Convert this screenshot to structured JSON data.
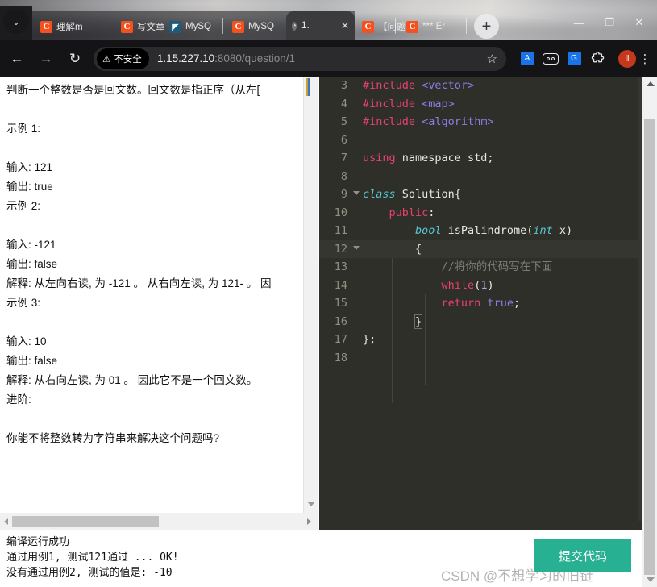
{
  "browser": {
    "tabs": [
      {
        "favicon": "csdn-icon",
        "favicon_text": "C",
        "title": "理解m"
      },
      {
        "favicon": "csdn-icon",
        "favicon_text": "C",
        "title": "写文章"
      },
      {
        "favicon": "mysql-icon",
        "favicon_text": "◤",
        "title": "MySQ"
      },
      {
        "favicon": "csdn-icon",
        "favicon_text": "C",
        "title": "MySQ"
      },
      {
        "favicon": "csdn-icon",
        "favicon_text": "C",
        "title": "【问题"
      },
      {
        "favicon": "csdn-icon",
        "favicon_text": "C",
        "title": "*** Er"
      }
    ],
    "active_tab": {
      "favicon": "globe-icon",
      "favicon_text": "◔",
      "title": "1.",
      "close": "✕"
    },
    "new_tab_label": "+",
    "chevron_label": "⌄",
    "window_controls": {
      "minimize": "—",
      "maximize": "❐",
      "close": "✕"
    },
    "nav": {
      "back": "←",
      "forward": "→",
      "reload": "↻"
    },
    "security": {
      "icon": "warning-triangle-icon",
      "glyph": "⚠",
      "label": "不安全"
    },
    "url": {
      "host": "1.15.227.10",
      "path": ":8080/question/1"
    },
    "star": "☆",
    "extensions": [
      {
        "name": "translate-extension-icon",
        "glyph": "A"
      },
      {
        "name": "goggles-extension-icon",
        "glyph": ""
      },
      {
        "name": "google-docs-extension-icon",
        "glyph": "G"
      },
      {
        "name": "extensions-puzzle-icon",
        "glyph": "⬡"
      }
    ],
    "profile_initial": "li",
    "menu_glyph": "⋮"
  },
  "problem": {
    "lines": [
      "判断一个整数是否是回文数。回文数是指正序（从左[",
      "",
      "示例 1:",
      "",
      "输入: 121",
      "输出: true",
      "示例 2:",
      "",
      "输入: -121",
      "输出: false",
      "解释: 从左向右读, 为 -121 。 从右向左读, 为 121- 。 因",
      "示例 3:",
      "",
      "输入: 10",
      "输出: false",
      "解释: 从右向左读, 为 01 。 因此它不是一个回文数。",
      "进阶:",
      "",
      "你能不将整数转为字符串来解决这个问题吗?"
    ]
  },
  "editor": {
    "lines": [
      {
        "num": "3",
        "fold": false,
        "tokens": [
          {
            "t": "#include",
            "c": "k-pre"
          },
          {
            "t": " ",
            "c": "k-id"
          },
          {
            "t": "<vector>",
            "c": "k-str"
          }
        ]
      },
      {
        "num": "4",
        "fold": false,
        "tokens": [
          {
            "t": "#include",
            "c": "k-pre"
          },
          {
            "t": " ",
            "c": "k-id"
          },
          {
            "t": "<map>",
            "c": "k-str"
          }
        ]
      },
      {
        "num": "5",
        "fold": false,
        "tokens": [
          {
            "t": "#include",
            "c": "k-pre"
          },
          {
            "t": " ",
            "c": "k-id"
          },
          {
            "t": "<algorithm>",
            "c": "k-str"
          }
        ]
      },
      {
        "num": "6",
        "fold": false,
        "tokens": []
      },
      {
        "num": "7",
        "fold": false,
        "tokens": [
          {
            "t": "using",
            "c": "k-kw"
          },
          {
            "t": " namespace ",
            "c": "k-kw2"
          },
          {
            "t": "std;",
            "c": "k-id"
          }
        ]
      },
      {
        "num": "8",
        "fold": false,
        "tokens": []
      },
      {
        "num": "9",
        "fold": true,
        "tokens": [
          {
            "t": "class",
            "c": "k-type"
          },
          {
            "t": " Solution{",
            "c": "k-id"
          }
        ]
      },
      {
        "num": "10",
        "fold": false,
        "tokens": [
          {
            "t": "    ",
            "c": "k-id"
          },
          {
            "t": "public",
            "c": "k-kw"
          },
          {
            "t": ":",
            "c": "k-id"
          }
        ]
      },
      {
        "num": "11",
        "fold": false,
        "tokens": [
          {
            "t": "        ",
            "c": "k-id"
          },
          {
            "t": "bool",
            "c": "k-type"
          },
          {
            "t": " isPalindrome(",
            "c": "k-id"
          },
          {
            "t": "int",
            "c": "k-type"
          },
          {
            "t": " x)",
            "c": "k-id"
          }
        ]
      },
      {
        "num": "12",
        "fold": true,
        "cur": true,
        "tokens": [
          {
            "t": "        {",
            "c": "k-id"
          }
        ],
        "caret": true
      },
      {
        "num": "13",
        "fold": false,
        "tokens": [
          {
            "t": "            ",
            "c": "k-id"
          },
          {
            "t": "//将你的代码写在下面",
            "c": "k-cmt"
          }
        ]
      },
      {
        "num": "14",
        "fold": false,
        "tokens": [
          {
            "t": "            ",
            "c": "k-id"
          },
          {
            "t": "while",
            "c": "k-kw"
          },
          {
            "t": "(",
            "c": "k-id"
          },
          {
            "t": "1",
            "c": "k-num"
          },
          {
            "t": ")",
            "c": "k-id"
          }
        ]
      },
      {
        "num": "15",
        "fold": false,
        "tokens": [
          {
            "t": "            ",
            "c": "k-id"
          },
          {
            "t": "return",
            "c": "k-kw"
          },
          {
            "t": " ",
            "c": "k-id"
          },
          {
            "t": "true",
            "c": "k-bool"
          },
          {
            "t": ";",
            "c": "k-id"
          }
        ]
      },
      {
        "num": "16",
        "fold": false,
        "tokens": [
          {
            "t": "        ",
            "c": "k-id"
          },
          {
            "t": "}",
            "c": "k-id",
            "hl": true
          }
        ]
      },
      {
        "num": "17",
        "fold": false,
        "tokens": [
          {
            "t": "};",
            "c": "k-id"
          }
        ]
      },
      {
        "num": "18",
        "fold": false,
        "tokens": []
      }
    ]
  },
  "output": {
    "lines": [
      "编译运行成功",
      "通过用例1, 测试121通过 ... OK!",
      "没有通过用例2, 测试的值是: -10"
    ]
  },
  "submit_button": {
    "label": "提交代码",
    "color": "#27b092"
  },
  "watermark": "CSDN @不想学习的旧链",
  "scrollbars": {
    "left_pane_v": {
      "up": "",
      "down": "▼"
    },
    "left_pane_h": {
      "left": "◀",
      "right": "▶"
    },
    "page_v": {
      "up": "▲",
      "down": "▼"
    }
  }
}
